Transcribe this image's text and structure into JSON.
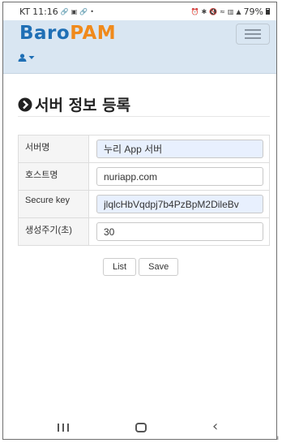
{
  "status_bar": {
    "carrier": "KT",
    "time": "11:16",
    "left_icons": [
      "link-icon",
      "image-icon",
      "link-icon",
      "dot-icon"
    ],
    "right_icons": [
      "alarm-icon",
      "bluetooth-icon",
      "mute-icon",
      "wifi-icon",
      "lte-icon",
      "signal-icon"
    ],
    "battery": "79%"
  },
  "header": {
    "brand_part1": "Baro",
    "brand_part2": "PAM",
    "brand_colors": {
      "part1": "#1f6fb5",
      "part2": "#f08a1c"
    },
    "background": "#d9e6f2",
    "menu_icon": "hamburger-icon",
    "user_icon": "user-icon",
    "user_caret": "caret-down-icon"
  },
  "page": {
    "title": "서버 정보 등록",
    "title_icon": "circle-arrow-right-icon"
  },
  "form": {
    "rows": [
      {
        "label": "서버명",
        "value": "누리 App 서버",
        "filled": true
      },
      {
        "label": "호스트명",
        "value": "nuriapp.com",
        "filled": false
      },
      {
        "label": "Secure key",
        "value": "jlqlcHbVqdpj7b4PzBpM2DileBv",
        "filled": true
      },
      {
        "label": "생성주기(초)",
        "value": "30",
        "filled": false
      }
    ]
  },
  "buttons": {
    "list_label": "List",
    "save_label": "Save"
  },
  "system_nav": {
    "icons": [
      "recent-apps-icon",
      "home-icon",
      "back-icon"
    ]
  }
}
